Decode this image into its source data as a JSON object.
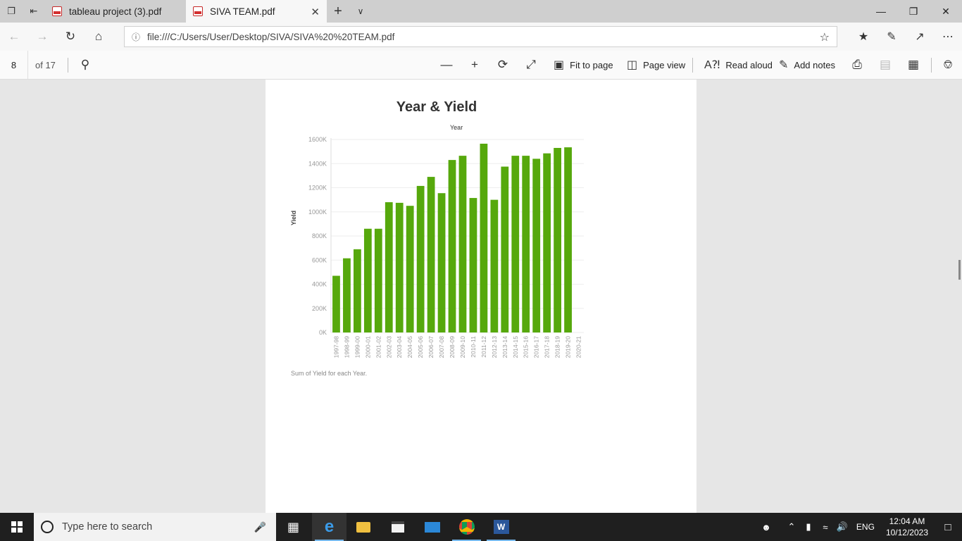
{
  "browser": {
    "tabs": [
      {
        "label": "tableau project (3).pdf",
        "active": false
      },
      {
        "label": "SIVA TEAM.pdf",
        "active": true
      }
    ],
    "url": "file:///C:/Users/User/Desktop/SIVA/SIVA%20%20TEAM.pdf"
  },
  "pdf_toolbar": {
    "page_number": "8",
    "page_count_label": "of 17",
    "fit_to_page": "Fit to page",
    "page_view": "Page view",
    "read_aloud": "Read aloud",
    "add_notes": "Add notes"
  },
  "chart_data": {
    "type": "bar",
    "title": "Year & Yield",
    "xlabel": "Year",
    "ylabel": "Yield",
    "caption": "Sum of Yield for each Year.",
    "categories": [
      "1997-98",
      "1998-99",
      "1999-00",
      "2000-01",
      "2001-02",
      "2002-03",
      "2003-04",
      "2004-05",
      "2005-06",
      "2006-07",
      "2007-08",
      "2008-09",
      "2009-10",
      "2010-11",
      "2011-12",
      "2012-13",
      "2013-14",
      "2014-15",
      "2015-16",
      "2016-17",
      "2017-18",
      "2018-19",
      "2019-20",
      "2020-21"
    ],
    "values": [
      470000,
      615000,
      690000,
      860000,
      860000,
      1080000,
      1075000,
      1050000,
      1215000,
      1290000,
      1155000,
      1430000,
      1465000,
      1115000,
      1565000,
      1100000,
      1375000,
      1465000,
      1465000,
      1440000,
      1485000,
      1530000,
      1535000,
      0
    ],
    "ylim": [
      0,
      1600000
    ],
    "yticks": [
      "0K",
      "200K",
      "400K",
      "600K",
      "800K",
      "1000K",
      "1200K",
      "1400K",
      "1600K"
    ],
    "color": "#56a80c",
    "grid": true
  },
  "taskbar": {
    "search_placeholder": "Type here to search",
    "language": "ENG",
    "time": "12:04 AM",
    "date": "10/12/2023"
  }
}
